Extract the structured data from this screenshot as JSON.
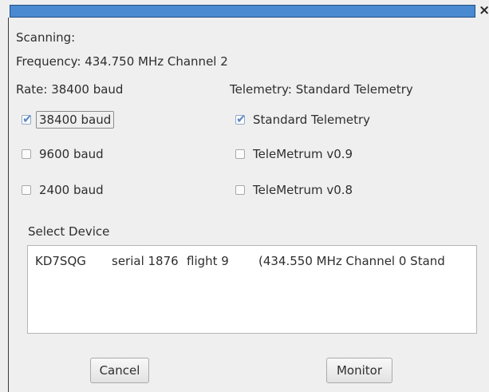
{
  "window": {
    "close_glyph": "×"
  },
  "status": {
    "scanning": "Scanning:",
    "frequency": "Frequency: 434.750 MHz Channel 2",
    "rate": "Rate: 38400 baud",
    "telemetry": "Telemetry: Standard Telemetry"
  },
  "rates": [
    {
      "label": "38400 baud",
      "checked": true
    },
    {
      "label": "9600 baud",
      "checked": false
    },
    {
      "label": "2400 baud",
      "checked": false
    }
  ],
  "telemetry_options": [
    {
      "label": "Standard Telemetry",
      "checked": true
    },
    {
      "label": "TeleMetrum v0.9",
      "checked": false
    },
    {
      "label": "TeleMetrum v0.8",
      "checked": false
    }
  ],
  "select_device": {
    "label": "Select Device",
    "devices": [
      {
        "callsign": "KD7SQG",
        "serial": "serial 1876",
        "flight": "flight 9",
        "info": "(434.550 MHz Channel 0 Stand"
      }
    ]
  },
  "buttons": {
    "cancel": "Cancel",
    "monitor": "Monitor"
  },
  "colors": {
    "title_bar": "#4a8ad0",
    "check_accent": "#5b88c7"
  }
}
